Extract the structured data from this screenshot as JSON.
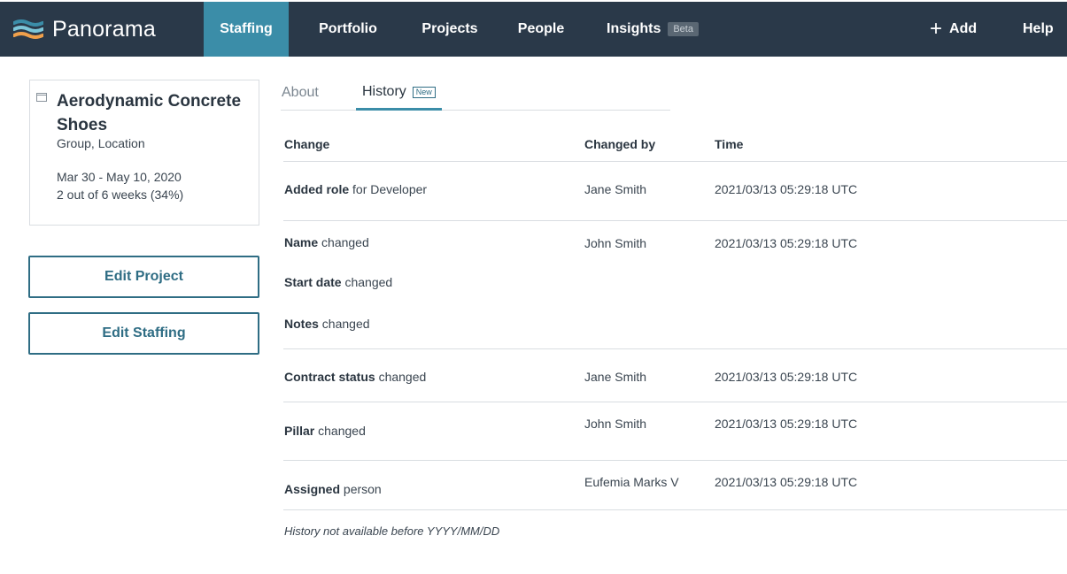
{
  "brand": {
    "name": "Panorama",
    "logo_colors": [
      "#3b8da8",
      "#7cc6d9",
      "#f0a04b"
    ]
  },
  "nav": {
    "items": [
      {
        "label": "Staffing",
        "active": true
      },
      {
        "label": "Portfolio",
        "active": false
      },
      {
        "label": "Projects",
        "active": false
      },
      {
        "label": "People",
        "active": false
      },
      {
        "label": "Insights",
        "active": false,
        "badge": "Beta"
      }
    ],
    "add_label": "Add",
    "help_label": "Help"
  },
  "project": {
    "title": "Aerodynamic Concrete Shoes",
    "meta": "Group,  Location",
    "dates": "Mar 30 - May 10, 2020",
    "progress_text": "2 out of 6 weeks (34%)",
    "progress_percent": 34
  },
  "actions": {
    "edit_project": "Edit Project",
    "edit_staffing": "Edit Staffing"
  },
  "tabs": {
    "about": "About",
    "history": "History",
    "history_badge": "New",
    "active": "History"
  },
  "history": {
    "columns": {
      "change": "Change",
      "changed_by": "Changed by",
      "time": "Time"
    },
    "rows": [
      {
        "changes": [
          {
            "field": "Added role",
            "action": "for Developer"
          }
        ],
        "changed_by": "Jane Smith",
        "time": "2021/03/13 05:29:18 UTC"
      },
      {
        "changes": [
          {
            "field": "Name",
            "action": "changed"
          },
          {
            "field": "Start date",
            "action": "changed"
          },
          {
            "field": "Notes",
            "action": "changed"
          }
        ],
        "changed_by": "John Smith",
        "time": "2021/03/13 05:29:18 UTC"
      },
      {
        "changes": [
          {
            "field": "Contract status",
            "action": "changed"
          }
        ],
        "changed_by": "Jane Smith",
        "time": "2021/03/13 05:29:18 UTC"
      },
      {
        "changes": [
          {
            "field": "Pillar",
            "action": "changed"
          }
        ],
        "changed_by": "John Smith",
        "time": "2021/03/13 05:29:18 UTC"
      },
      {
        "changes": [
          {
            "field": "Assigned",
            "action": "person"
          }
        ],
        "changed_by": "Eufemia Marks V",
        "time": "2021/03/13 05:29:18 UTC"
      }
    ],
    "footnote": "History not available before YYYY/MM/DD"
  },
  "colors": {
    "topbar": "#2a3949",
    "active_nav": "#3b8da8",
    "button_outline": "#2f6d84",
    "divider": "#d9dde1"
  }
}
